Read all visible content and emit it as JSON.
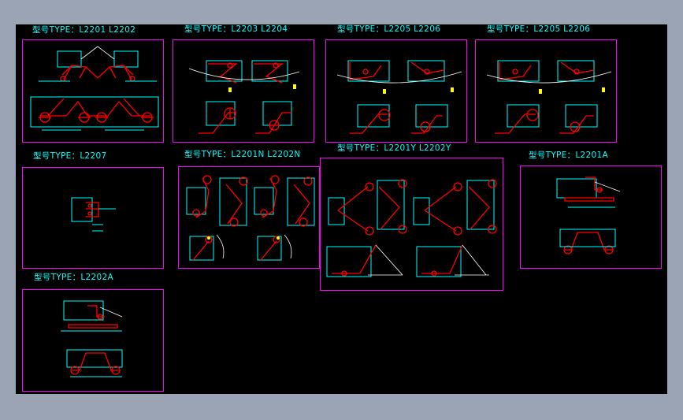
{
  "panels": [
    {
      "id": "p1",
      "title": "型号TYPE：L2201 L2202"
    },
    {
      "id": "p2",
      "title": "型号TYPE：L2203 L2204"
    },
    {
      "id": "p3",
      "title": "型号TYPE：L2205 L2206"
    },
    {
      "id": "p4",
      "title": "型号TYPE：L2205 L2206"
    },
    {
      "id": "p5",
      "title": "型号TYPE：L2207"
    },
    {
      "id": "p6",
      "title": "型号TYPE：L2201N L2202N"
    },
    {
      "id": "p7",
      "title": "型号TYPE：L2201Y L2202Y"
    },
    {
      "id": "p8",
      "title": "型号TYPE：L2201A"
    },
    {
      "id": "p9",
      "title": "型号TYPE：L2202A"
    }
  ],
  "colors": {
    "background": "#000000",
    "frame": "#ff00ff",
    "title": "#00ffff",
    "dimension": "#00ffff",
    "part": "#ff0000",
    "marker": "#ffff00",
    "window": "#9aa4b5"
  }
}
